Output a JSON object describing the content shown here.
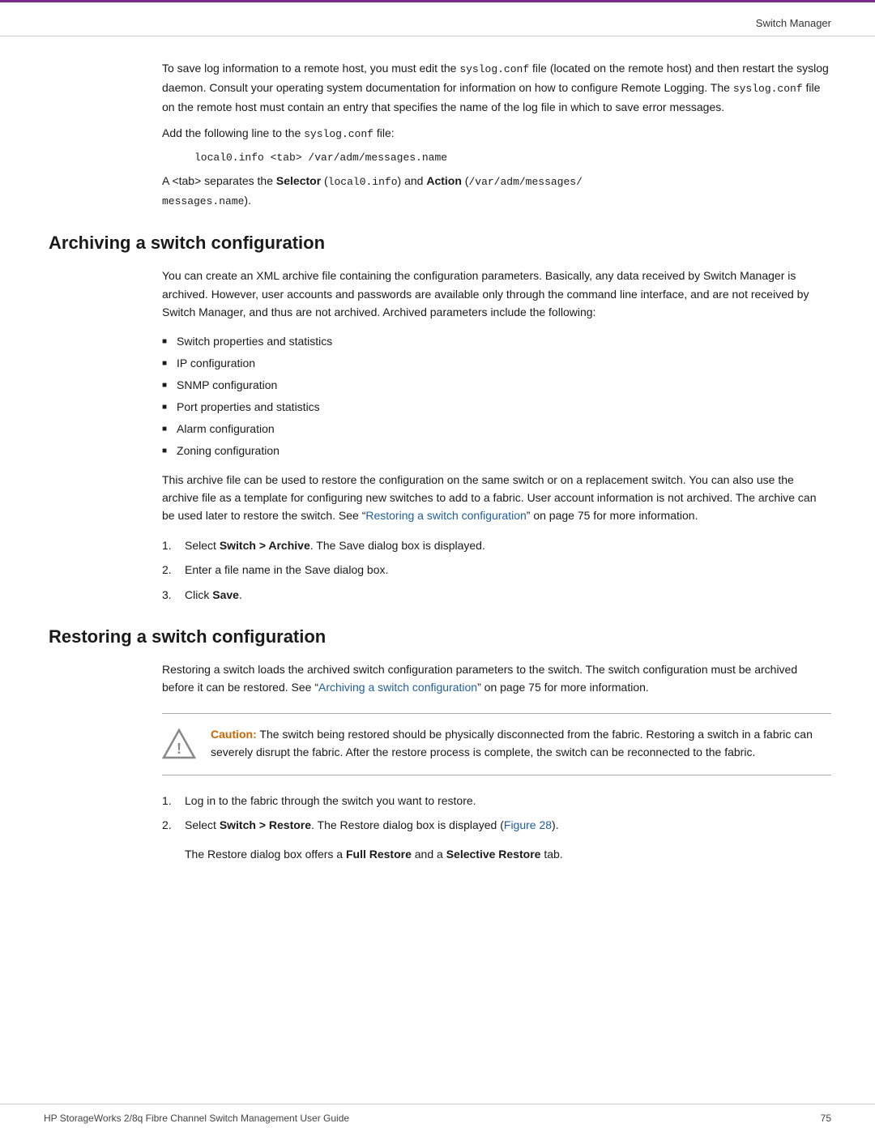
{
  "header": {
    "title": "Switch Manager"
  },
  "footer": {
    "left": "HP StorageWorks 2/8q Fibre Channel Switch Management User Guide",
    "right": "75"
  },
  "intro": {
    "para1": "To save log information to a remote host, you must edit the ",
    "code1": "syslog.conf",
    "para1b": " file (located on the remote host) and then restart the syslog daemon. Consult your operating system documentation for information on how to configure Remote Logging. The ",
    "code2": "syslog.conf",
    "para1c": " file on the remote host must contain an entry that specifies the name of the log file in which to save error messages.",
    "para2_prefix": "Add the following line to the ",
    "code3": "syslog.conf",
    "para2_suffix": " file:",
    "code_block": "local0.info <tab> /var/adm/messages.name",
    "para3_prefix": "A <tab> separates the ",
    "bold1": "Selector",
    "code4": " (local0.info)",
    "para3_mid": " and ",
    "bold2": "Action",
    "code5": " (/var/adm/messages/\nmessages.name",
    "para3_suffix": ")."
  },
  "archiving": {
    "heading": "Archiving a switch configuration",
    "para1": "You can create an XML archive file containing the configuration parameters. Basically, any data received by Switch Manager is archived. However, user accounts and passwords are available only through the command line interface, and are not received by Switch Manager, and thus are not archived. Archived parameters include the following:",
    "bullets": [
      "Switch properties and statistics",
      "IP configuration",
      "SNMP configuration",
      "Port properties and statistics",
      "Alarm configuration",
      "Zoning configuration"
    ],
    "para2_prefix": "This archive file can be used to restore the configuration on the same switch or on a replacement switch. You can also use the archive file as a template for configuring new switches to add to a fabric. User account information is not archived. The archive can be used later to restore the switch. See “",
    "link1": "Restoring a switch configuration",
    "para2_mid": "” on page 75 for more information.",
    "steps": [
      {
        "num": "1.",
        "text_prefix": "Select ",
        "bold": "Switch > Archive",
        "text_suffix": ". The Save dialog box is displayed."
      },
      {
        "num": "2.",
        "text": "Enter a file name in the Save dialog box."
      },
      {
        "num": "3.",
        "text_prefix": "Click ",
        "bold": "Save",
        "text_suffix": "."
      }
    ]
  },
  "restoring": {
    "heading": "Restoring a switch configuration",
    "para1_prefix": "Restoring a switch loads the archived switch configuration parameters to the switch. The switch configuration must be archived before it can be restored. See “",
    "link1": "Archiving a switch configuration",
    "para1_mid": "” on page 75 for more information.",
    "caution": {
      "label": "Caution:",
      "text": " The switch being restored should be physically disconnected from the fabric. Restoring a switch in a fabric can severely disrupt the fabric. After the restore process is complete, the switch can be reconnected to the fabric."
    },
    "steps": [
      {
        "num": "1.",
        "text": "Log in to the fabric through the switch you want to restore."
      },
      {
        "num": "2.",
        "text_prefix": "Select ",
        "bold": "Switch > Restore",
        "text_mid": ". The Restore dialog box is displayed (",
        "link": "Figure 28",
        "text_suffix": ")."
      }
    ],
    "sub_note_prefix": "The Restore dialog box offers a ",
    "bold1": "Full Restore",
    "sub_note_mid": " and a ",
    "bold2": "Selective Restore",
    "sub_note_suffix": " tab."
  }
}
